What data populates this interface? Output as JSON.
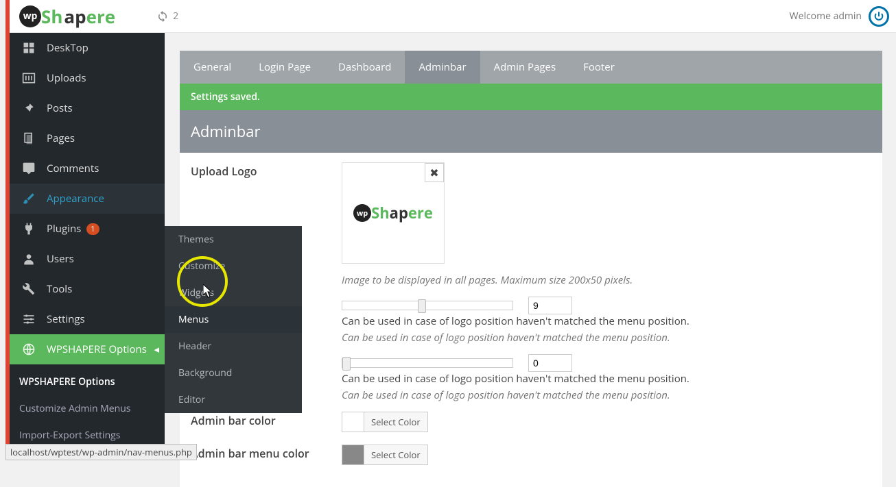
{
  "topbar": {
    "notif_count": "2",
    "welcome": "Welcome admin"
  },
  "sidebar": {
    "items": [
      {
        "label": "DeskTop"
      },
      {
        "label": "Uploads"
      },
      {
        "label": "Posts"
      },
      {
        "label": "Pages"
      },
      {
        "label": "Comments"
      },
      {
        "label": "Appearance"
      },
      {
        "label": "Plugins",
        "badge": "1"
      },
      {
        "label": "Users"
      },
      {
        "label": "Tools"
      },
      {
        "label": "Settings"
      },
      {
        "label": "WPSHAPERE Options"
      }
    ],
    "sub": [
      {
        "label": "WPSHAPERE Options"
      },
      {
        "label": "Customize Admin Menus"
      },
      {
        "label": "Import-Export Settings"
      }
    ]
  },
  "flyout": {
    "items": [
      {
        "label": "Themes"
      },
      {
        "label": "Customize"
      },
      {
        "label": "Widgets"
      },
      {
        "label": "Menus"
      },
      {
        "label": "Header"
      },
      {
        "label": "Background"
      },
      {
        "label": "Editor"
      }
    ]
  },
  "tabs": [
    {
      "label": "General"
    },
    {
      "label": "Login Page"
    },
    {
      "label": "Dashboard"
    },
    {
      "label": "Adminbar"
    },
    {
      "label": "Admin Pages"
    },
    {
      "label": "Footer"
    }
  ],
  "alert": "Settings saved.",
  "page_title": "Adminbar",
  "form": {
    "upload_label": "Upload Logo",
    "upload_help": "Image to be displayed in all pages. Maximum size 200x50 pixels.",
    "slider1_value": "9",
    "slider1_desc": "Can be used in case of logo position haven't matched the menu position.",
    "slider1_help": "Can be used in case of logo position haven't matched the menu position.",
    "slider2_value": "0",
    "slider2_desc": "Can be used in case of logo position haven't matched the menu position.",
    "slider2_help": "Can be used in case of logo position haven't matched the menu position.",
    "color1_label": "Admin bar color",
    "color2_label": "Admin bar menu color",
    "select_color": "Select Color"
  },
  "status": "localhost/wptest/wp-admin/nav-menus.php"
}
